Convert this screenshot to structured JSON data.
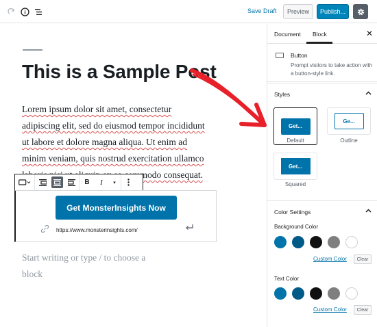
{
  "topbar": {
    "save_draft": "Save Draft",
    "preview": "Preview",
    "publish": "Publish..."
  },
  "editor": {
    "title": "This is a Sample Post",
    "paragraph_lines": [
      " Lorem ipsum dolor sit amet, consectetur",
      "adipiscing elit, sed do eiusmod tempor incididunt",
      "ut labore et dolore magna aliqua. Ut enim ad",
      "minim veniam, quis nostrud exercitation ullamco",
      "laboris nisi ut aliquip ex ea commodo consequat."
    ],
    "button_text": "Get MonsterInsights Now",
    "button_url": "https://www.monsterinsights.com/",
    "placeholder": "Start writing or type / to choose a block"
  },
  "sidebar": {
    "tabs": [
      "Document",
      "Block"
    ],
    "active_tab": "Block",
    "block_name": "Button",
    "block_description": "Prompt visitors to take action with a button-style link.",
    "styles_title": "Styles",
    "styles": [
      {
        "preview": "Get...",
        "label": "Default",
        "selected": true
      },
      {
        "preview": "Ge...",
        "label": "Outline",
        "selected": false
      },
      {
        "preview": "Get...",
        "label": "Squared",
        "selected": false
      }
    ],
    "color_settings_title": "Color Settings",
    "background_color_label": "Background Color",
    "text_color_label": "Text Color",
    "custom_color": "Custom Color",
    "clear": "Clear",
    "palette": [
      "#0073aa",
      "#005a87",
      "#111111",
      "#7f7f7f",
      "#ffffff"
    ]
  },
  "colors": {
    "accent": "#0073aa",
    "publish": "#0085ba",
    "arrow": "#e8202a"
  }
}
